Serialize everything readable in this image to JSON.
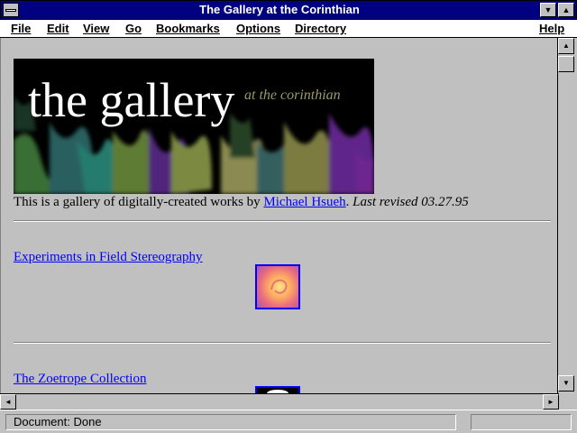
{
  "window": {
    "title": "The Gallery at the Corinthian"
  },
  "menu": [
    "File",
    "Edit",
    "View",
    "Go",
    "Bookmarks",
    "Options",
    "Directory",
    "Help"
  ],
  "banner": {
    "title": "the gallery",
    "subtitle": "at the corinthian"
  },
  "intro": {
    "prefix": "This is a gallery of digitally-created works by ",
    "author_link": "Michael Hsueh",
    "separator": ". ",
    "revised": "Last revised 03.27.95"
  },
  "gallery": [
    {
      "link": "Experiments in Field Stereography "
    },
    {
      "link": "The Zoetrope Collection "
    }
  ],
  "status": {
    "text": "Document: Done"
  },
  "colors": {
    "titlebar": "#000080",
    "link": "#0000ff",
    "window_bg": "#c0c0c0"
  }
}
